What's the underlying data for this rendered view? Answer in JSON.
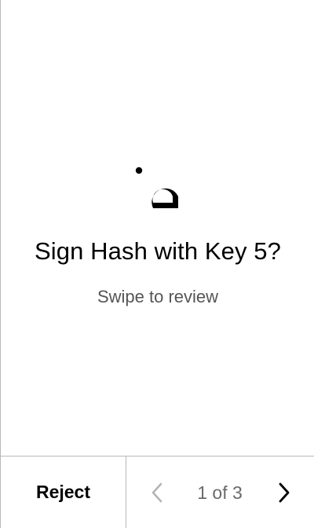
{
  "review": {
    "title": "Sign Hash with Key 5?",
    "subtitle": "Swipe to review"
  },
  "footer": {
    "reject_label": "Reject",
    "page_indicator": "1 of 3"
  },
  "icons": {
    "app_logo": "app-logo-icon",
    "previous": "chevron-left-icon",
    "next": "chevron-right-icon"
  },
  "colors": {
    "text_primary": "#000000",
    "text_secondary": "#555555",
    "disabled": "#b3b3b3",
    "divider": "#b8b8b8"
  }
}
